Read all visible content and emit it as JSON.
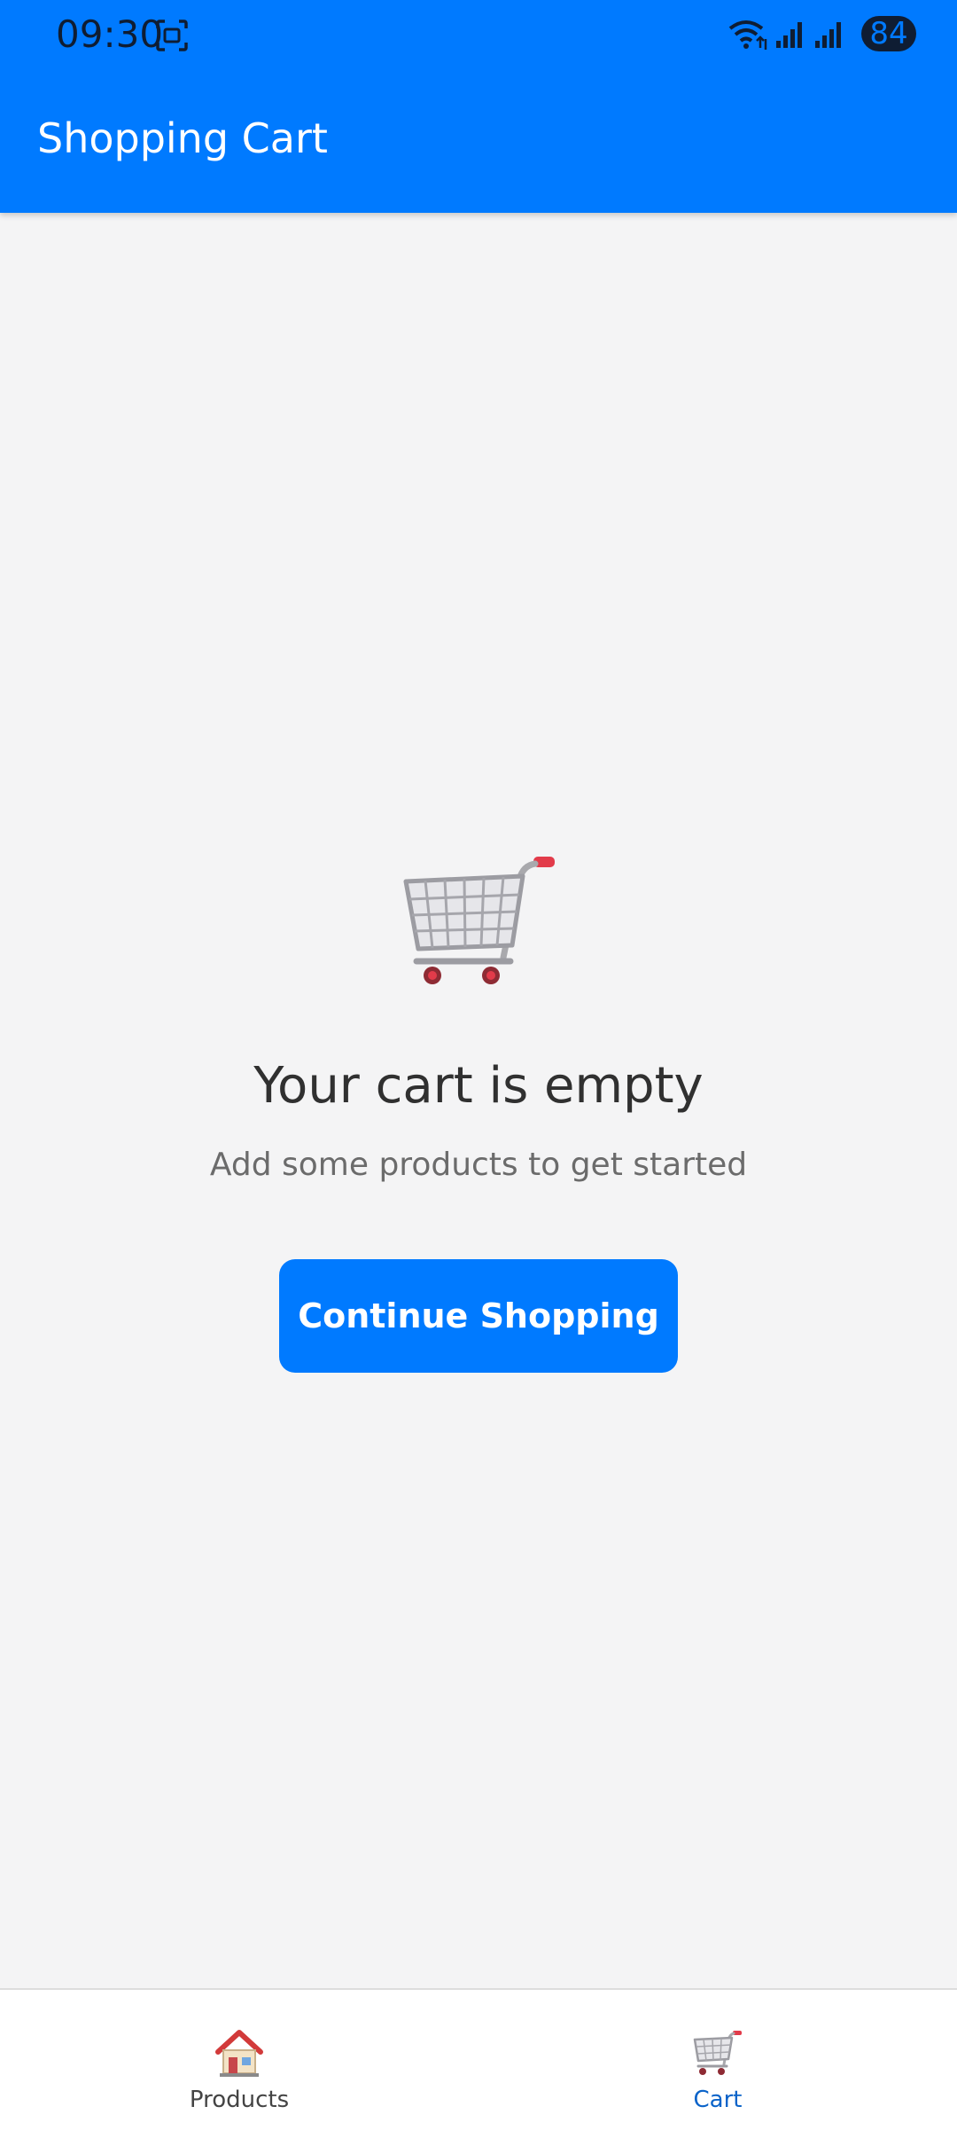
{
  "status_bar": {
    "time": "09:30",
    "battery": "84"
  },
  "app_bar": {
    "title": "Shopping Cart"
  },
  "empty_state": {
    "icon": "shopping-cart-icon",
    "title": "Your cart is empty",
    "subtitle": "Add some products to get started",
    "button_label": "Continue Shopping"
  },
  "bottom_nav": {
    "items": [
      {
        "label": "Products",
        "icon": "house-icon",
        "active": false
      },
      {
        "label": "Cart",
        "icon": "shopping-cart-icon",
        "active": true
      }
    ]
  },
  "colors": {
    "primary": "#007aff",
    "background": "#f4f4f5",
    "text_dark": "#303030",
    "text_muted": "#6b6b6b",
    "nav_inactive": "#444444",
    "nav_active": "#0a63c9"
  }
}
